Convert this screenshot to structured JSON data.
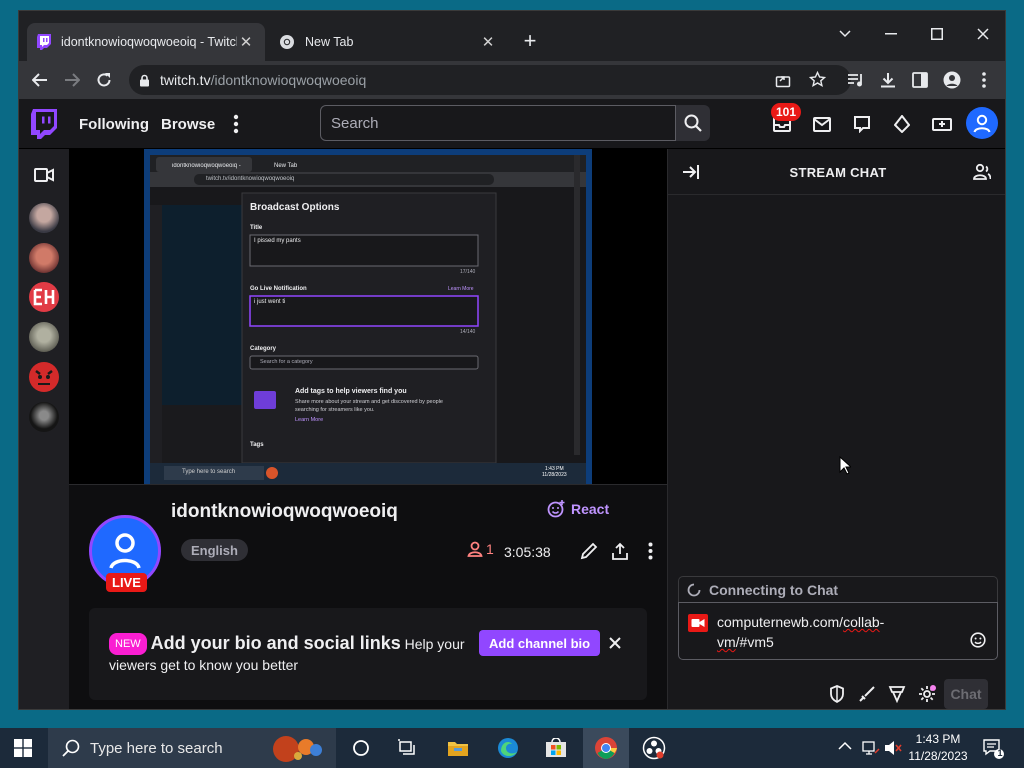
{
  "browser": {
    "tabs": [
      {
        "title": "idontknowioqwoqwoeoiq - Twitch"
      },
      {
        "title": "New Tab"
      }
    ],
    "new_tab_glyph": "+",
    "url_host": "twitch.tv",
    "url_path": "/idontknowioqwoqwoeoiq"
  },
  "twitch_nav": {
    "following": "Following",
    "browse": "Browse",
    "search_placeholder": "Search",
    "notif_count": "101"
  },
  "stream_preview": {
    "tab1": "idontknowioqwoqwoeoiq - Twitch",
    "tab2": "New Tab",
    "url": "twitch.tv/idontknowioqwoqwoeoiq",
    "dialog_title": "Broadcast Options",
    "title_label": "Title",
    "title_value": "I pissed my pants",
    "title_count": "17/140",
    "golive_label": "Go Live Notification",
    "learn_more": "Learn More",
    "golive_value": "i just went ti",
    "golive_count": "14/140",
    "category_label": "Category",
    "category_placeholder": "Search for a category",
    "tags_heading": "Add tags to help viewers find you",
    "tags_body": "Share more about your stream and get discovered by people searching for streamers like you.",
    "tags_learn": "Learn More",
    "tags_label": "Tags",
    "taskbar_search": "Type here to search",
    "time": "1:43 PM",
    "date": "11/28/2023"
  },
  "channel": {
    "name": "idontknowioqwoqwoeoiq",
    "language": "English",
    "live": "LIVE",
    "react": "React",
    "viewers": "1",
    "uptime": "3:05:38",
    "bio_new": "NEW",
    "bio_heading": "Add your bio and social links",
    "bio_text": "Help your viewers get to know you better",
    "bio_button": "Add channel bio"
  },
  "chat": {
    "title": "STREAM CHAT",
    "connecting": "Connecting to Chat",
    "input_part1": "computernewb.com/",
    "input_part2": "collab",
    "input_part3": "-",
    "input_part4": "vm",
    "input_part5": "/#vm5",
    "send": "Chat"
  },
  "taskbar": {
    "search_placeholder": "Type here to search",
    "time": "1:43 PM",
    "date": "11/28/2023",
    "notif": "1"
  },
  "colors": {
    "twitch_purple": "#9147ff",
    "live_red": "#e91916",
    "chrome_dark": "#202124"
  }
}
